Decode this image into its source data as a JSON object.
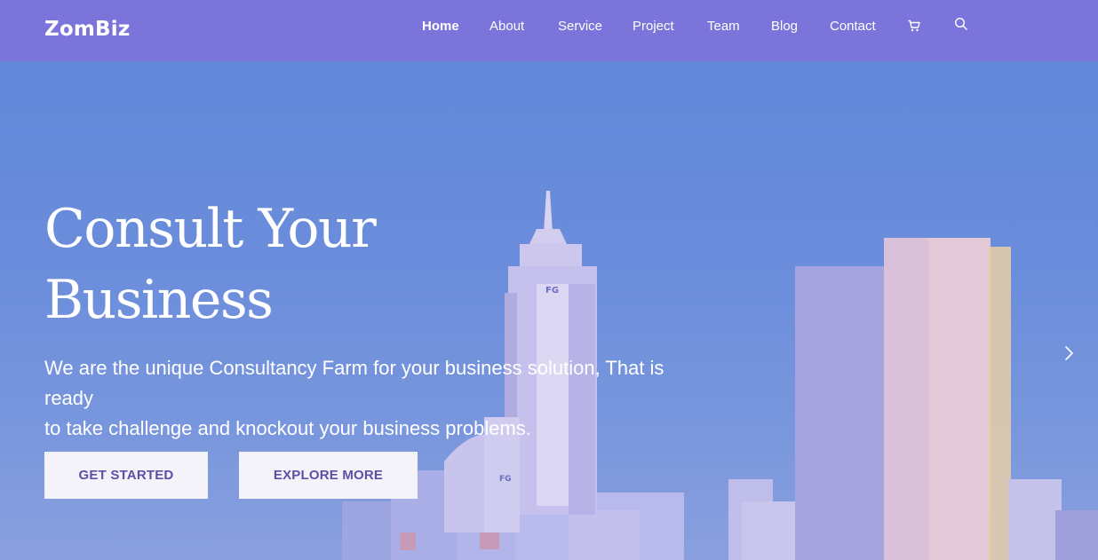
{
  "brand": {
    "name": "ZomBiz"
  },
  "nav": {
    "items": [
      {
        "label": "Home",
        "active": true
      },
      {
        "label": "About",
        "active": false
      },
      {
        "label": "Service",
        "active": false
      },
      {
        "label": "Project",
        "active": false
      },
      {
        "label": "Team",
        "active": false
      },
      {
        "label": "Blog",
        "active": false
      },
      {
        "label": "Contact",
        "active": false
      }
    ],
    "icons": [
      "cart-icon",
      "search-icon"
    ]
  },
  "hero": {
    "headline_line1": "Consult Your",
    "headline_line2": "Business",
    "subtext_line1": "We are the unique Consultancy Farm for your business solution, That is ready",
    "subtext_line2": "to take challenge and knockout your business problems.",
    "primary_button": "GET STARTED",
    "secondary_button": "EXPLORE MORE",
    "next_icon": "chevron-right-icon"
  },
  "colors": {
    "header_bg": "#7b74da",
    "hero_overlay": "#6b86d8",
    "button_bg": "#f4f3fa",
    "button_text": "#5b4fa6",
    "text": "#ffffff"
  }
}
